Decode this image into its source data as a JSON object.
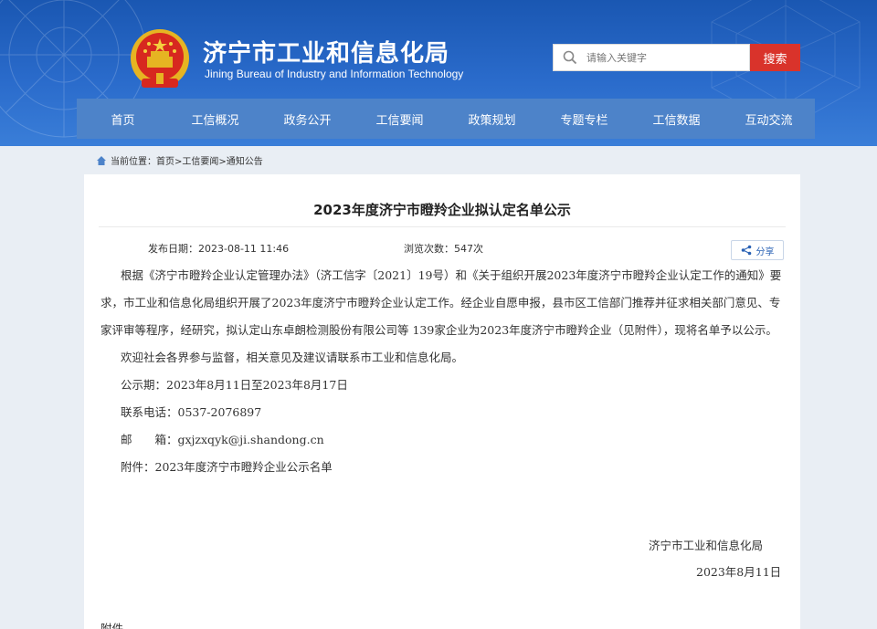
{
  "header": {
    "title": "济宁市工业和信息化局",
    "subtitle": "Jining Bureau of Industry and Information Technology",
    "search_placeholder": "请输入关键字",
    "search_button": "搜索"
  },
  "nav": {
    "items": [
      "首页",
      "工信概况",
      "政务公开",
      "工信要闻",
      "政策规划",
      "专题专栏",
      "工信数据",
      "互动交流"
    ]
  },
  "breadcrumb": {
    "text": "当前位置：首页>工信要闻>通知公告"
  },
  "article": {
    "title": "2023年度济宁市瞪羚企业拟认定名单公示",
    "publish_date": "发布日期：2023-08-11 11:46",
    "views": "浏览次数：547次",
    "share_label": "分享",
    "paragraph1": "根据《济宁市瞪羚企业认定管理办法》（济工信字〔2021〕19号）和《关于组织开展2023年度济宁市瞪羚企业认定工作的通知》要求，市工业和信息化局组织开展了2023年度济宁市瞪羚企业认定工作。经企业自愿申报，县市区工信部门推荐并征求相关部门意见、专家评审等程序，经研究，拟认定山东卓朗检测股份有限公司等 139家企业为2023年度济宁市瞪羚企业（见附件），现将名单予以公示。",
    "paragraph2": "欢迎社会各界参与监督，相关意见及建议请联系市工业和信息化局。",
    "period": "公示期：2023年8月11日至2023年8月17日",
    "phone": "联系电话：0537-2076897",
    "email": "邮　　箱：gxjzxqyk@ji.shandong.cn",
    "attachment_line": "附件：2023年度济宁市瞪羚企业公示名单",
    "signature_org": "济宁市工业和信息化局",
    "signature_date": "2023年8月11日",
    "attachment_heading": "附件"
  },
  "colors": {
    "header_blue": "#1a57b2",
    "nav_blue": "#4d83c9",
    "search_red": "#d9332b"
  },
  "icons": [
    "emblem-icon",
    "search-icon",
    "home-icon",
    "share-icon"
  ]
}
